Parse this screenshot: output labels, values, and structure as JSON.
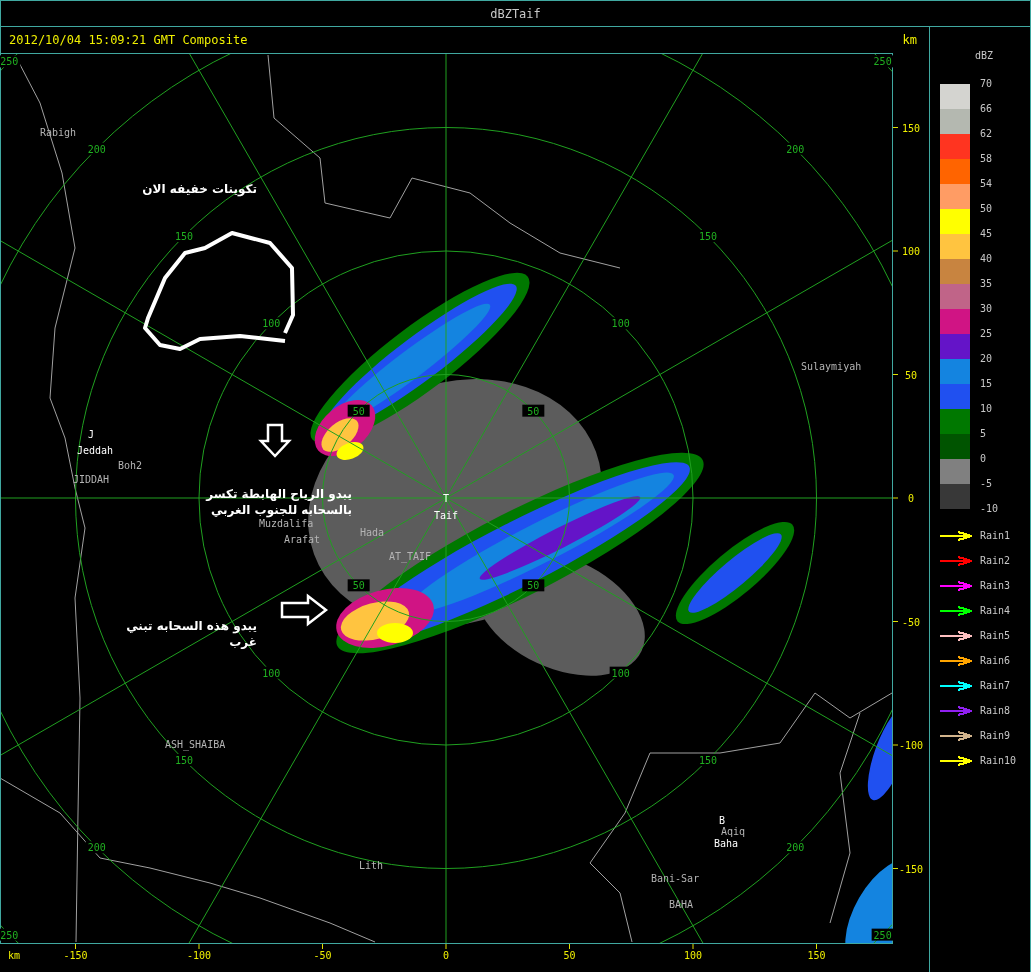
{
  "window": {
    "title": "dBZTaif"
  },
  "header": {
    "timestamp": "2012/10/04 15:09:21 GMT Composite",
    "unit": "km"
  },
  "map": {
    "range_rings": [
      {
        "labels": [
          "50",
          "50",
          "50",
          "50"
        ]
      },
      {
        "labels": [
          "100",
          "100",
          "100",
          "100"
        ]
      },
      {
        "labels": [
          "150",
          "150",
          "150",
          "150"
        ]
      },
      {
        "labels": [
          "200",
          "200",
          "200",
          "200"
        ]
      },
      {
        "labels": [
          "250",
          "250",
          "250",
          "250"
        ]
      }
    ],
    "places": [
      {
        "name": "Rabigh",
        "kind": "town"
      },
      {
        "name": "J",
        "kind": "site"
      },
      {
        "name": "Jeddah",
        "kind": "site"
      },
      {
        "name": "Boh2",
        "kind": "town"
      },
      {
        "name": "JIDDAH",
        "kind": "town"
      },
      {
        "name": "Muzdalifa",
        "kind": "town"
      },
      {
        "name": "Arafat",
        "kind": "town"
      },
      {
        "name": "Hada",
        "kind": "town"
      },
      {
        "name": "AT_TAIF",
        "kind": "town"
      },
      {
        "name": "T",
        "kind": "site"
      },
      {
        "name": "Taif",
        "kind": "site"
      },
      {
        "name": "Sulaymiyah",
        "kind": "town"
      },
      {
        "name": "ASH_SHAIBA",
        "kind": "town"
      },
      {
        "name": "Lith",
        "kind": "town"
      },
      {
        "name": "B",
        "kind": "site"
      },
      {
        "name": "Aqiq",
        "kind": "town"
      },
      {
        "name": "Baha",
        "kind": "site"
      },
      {
        "name": "Bani-Sar",
        "kind": "town"
      },
      {
        "name": "BAHA",
        "kind": "town"
      }
    ],
    "annotations": [
      {
        "kind": "text",
        "lines": [
          "تكوينات خفيفه الان"
        ]
      },
      {
        "kind": "loop"
      },
      {
        "kind": "down_arrow"
      },
      {
        "kind": "text",
        "lines": [
          "يبدو الرياح الهابطة تكسر",
          "بالسحابه للجنوب الغربي"
        ]
      },
      {
        "kind": "right_arrow"
      },
      {
        "kind": "text",
        "lines": [
          "يبدو هذه السحابه تبني",
          "غرب"
        ]
      }
    ],
    "y_axis": {
      "ticks": [
        "150",
        "100",
        "50",
        "0",
        "-50",
        "-100",
        "-150"
      ]
    },
    "x_axis": {
      "unit": "km",
      "ticks": [
        "-150",
        "-100",
        "-50",
        "0",
        "50",
        "100",
        "150"
      ]
    }
  },
  "legend": {
    "title": "dBZ",
    "items": [
      {
        "label": "70",
        "color": "#d4d4d0"
      },
      {
        "label": "66",
        "color": "#b4b8b0"
      },
      {
        "label": "62",
        "color": "#ff3420"
      },
      {
        "label": "58",
        "color": "#ff6400"
      },
      {
        "label": "54",
        "color": "#ff9c64"
      },
      {
        "label": "50",
        "color": "#ffff00"
      },
      {
        "label": "45",
        "color": "#ffc440"
      },
      {
        "label": "40",
        "color": "#c88440"
      },
      {
        "label": "35",
        "color": "#c06488"
      },
      {
        "label": "30",
        "color": "#d01484"
      },
      {
        "label": "25",
        "color": "#6414c8"
      },
      {
        "label": "20",
        "color": "#1484e0"
      },
      {
        "label": "15",
        "color": "#2050f0"
      },
      {
        "label": "10",
        "color": "#007800"
      },
      {
        "label": "5",
        "color": "#005400"
      },
      {
        "label": "0",
        "color": "#808080"
      },
      {
        "label": "-5",
        "color": "#383838"
      }
    ],
    "bottom_label": "-10",
    "tracks": [
      {
        "label": "Rain1",
        "color": "#ffff00"
      },
      {
        "label": "Rain2",
        "color": "#ff0000"
      },
      {
        "label": "Rain3",
        "color": "#ff00ff"
      },
      {
        "label": "Rain4",
        "color": "#00ff00"
      },
      {
        "label": "Rain5",
        "color": "#ffc0c0"
      },
      {
        "label": "Rain6",
        "color": "#ffa500"
      },
      {
        "label": "Rain7",
        "color": "#00ffff"
      },
      {
        "label": "Rain8",
        "color": "#9020f0"
      },
      {
        "label": "Rain9",
        "color": "#d2b48c"
      },
      {
        "label": "Rain10",
        "color": "#ffff00"
      }
    ]
  }
}
